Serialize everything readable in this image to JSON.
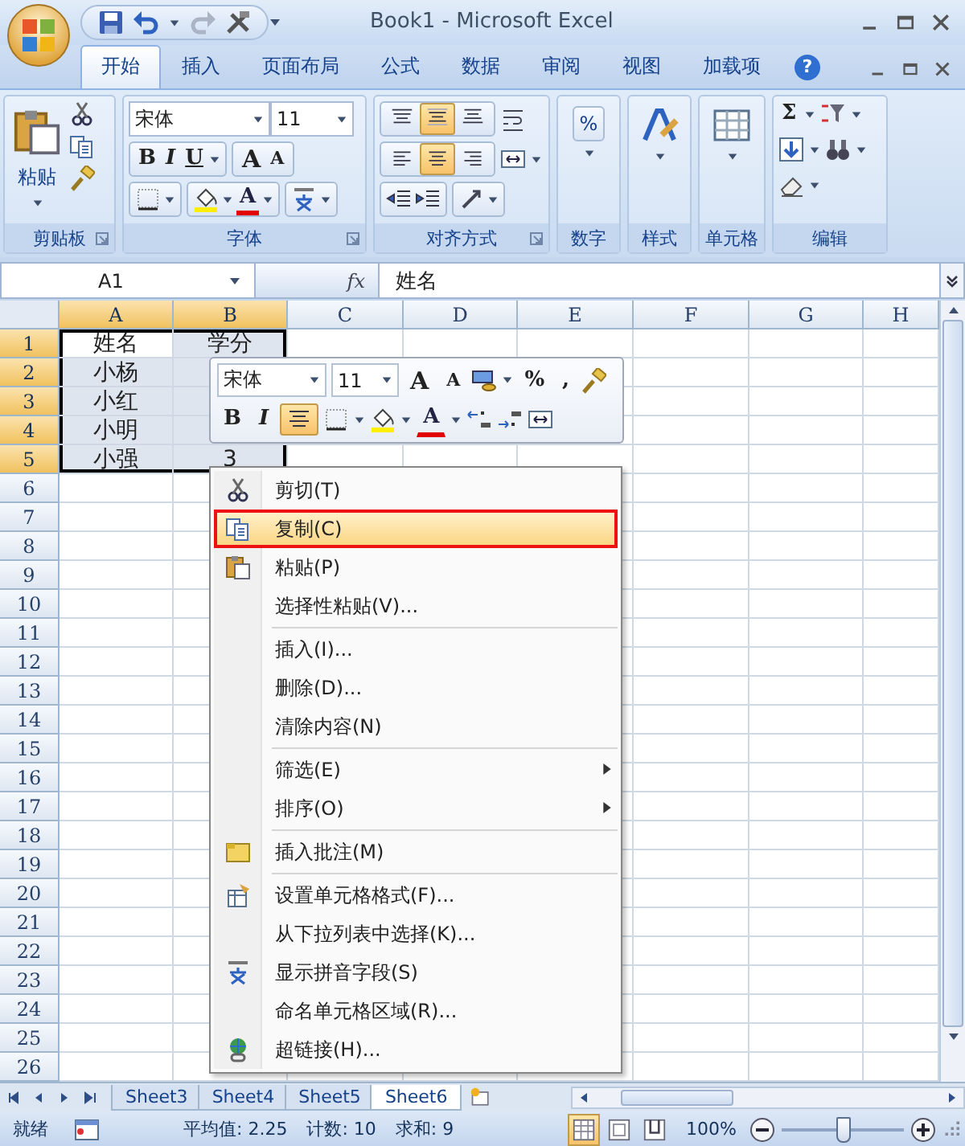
{
  "window": {
    "title": "Book1 - Microsoft Excel"
  },
  "ribbon_tabs": [
    {
      "label": "开始",
      "selected": true
    },
    {
      "label": "插入",
      "selected": false
    },
    {
      "label": "页面布局",
      "selected": false
    },
    {
      "label": "公式",
      "selected": false
    },
    {
      "label": "数据",
      "selected": false
    },
    {
      "label": "审阅",
      "selected": false
    },
    {
      "label": "视图",
      "selected": false
    },
    {
      "label": "加载项",
      "selected": false
    }
  ],
  "help_symbol": "?",
  "ribbon_groups": [
    {
      "kind": "clipboard",
      "label": "剪贴板",
      "paste": "粘贴"
    },
    {
      "kind": "font",
      "label": "字体",
      "font": "宋体",
      "size": "11",
      "styles": [
        "B",
        "I",
        "U"
      ],
      "grow": "A",
      "shrink": "A",
      "font_color": "A"
    },
    {
      "kind": "alignment",
      "label": "对齐方式",
      "vertical": [
        {
          "selected": false
        },
        {
          "selected": true
        },
        {
          "selected": false
        }
      ],
      "horizontal": [
        {
          "selected": false
        },
        {
          "selected": true
        },
        {
          "selected": false
        }
      ]
    },
    {
      "kind": "number",
      "label": "数字",
      "symbol": "%"
    },
    {
      "kind": "styles",
      "label": "样式"
    },
    {
      "kind": "cells",
      "label": "单元格"
    },
    {
      "kind": "editing",
      "label": "编辑",
      "sum_symbol": "Σ"
    }
  ],
  "formula_bar": {
    "name_box": "A1",
    "fx": "fx",
    "value": "姓名"
  },
  "columns": [
    {
      "label": "A",
      "selected": true
    },
    {
      "label": "B",
      "selected": true
    },
    {
      "label": "C",
      "selected": false
    },
    {
      "label": "D",
      "selected": false
    },
    {
      "label": "E",
      "selected": false
    },
    {
      "label": "F",
      "selected": false
    },
    {
      "label": "G",
      "selected": false
    },
    {
      "label": "H",
      "selected": false
    }
  ],
  "rows": [
    {
      "label": "1",
      "selected": true,
      "cells": [
        "姓名",
        "学分"
      ]
    },
    {
      "label": "2",
      "selected": true,
      "cells": [
        "小杨"
      ]
    },
    {
      "label": "3",
      "selected": true,
      "cells": [
        "小红"
      ]
    },
    {
      "label": "4",
      "selected": true,
      "cells": [
        "小明"
      ]
    },
    {
      "label": "5",
      "selected": true,
      "cells": [
        "小强",
        "3"
      ]
    },
    {
      "label": "6",
      "selected": false
    },
    {
      "label": "7",
      "selected": false
    },
    {
      "label": "8",
      "selected": false
    },
    {
      "label": "9",
      "selected": false
    },
    {
      "label": "10",
      "selected": false
    },
    {
      "label": "11",
      "selected": false
    },
    {
      "label": "12",
      "selected": false
    },
    {
      "label": "13",
      "selected": false
    },
    {
      "label": "14",
      "selected": false
    },
    {
      "label": "15",
      "selected": false
    },
    {
      "label": "16",
      "selected": false
    },
    {
      "label": "17",
      "selected": false
    },
    {
      "label": "18",
      "selected": false
    },
    {
      "label": "19",
      "selected": false
    },
    {
      "label": "20",
      "selected": false
    },
    {
      "label": "21",
      "selected": false
    },
    {
      "label": "22",
      "selected": false
    },
    {
      "label": "23",
      "selected": false
    },
    {
      "label": "24",
      "selected": false
    },
    {
      "label": "25",
      "selected": false
    },
    {
      "label": "26",
      "selected": false
    }
  ],
  "mini_toolbar": {
    "font": "宋体",
    "size": "11",
    "grow": "A",
    "shrink": "A",
    "percent": "%",
    "comma": ",",
    "bold": "B",
    "italic": "I",
    "center_selected": true,
    "font_color": "A"
  },
  "context_menu": {
    "items": [
      {
        "kind": "item",
        "label": "剪切(T)",
        "selected": false
      },
      {
        "kind": "item",
        "label": "复制(C)",
        "selected": true
      },
      {
        "kind": "item",
        "label": "粘贴(P)",
        "selected": false
      },
      {
        "kind": "item",
        "label": "选择性粘贴(V)...",
        "selected": false
      },
      {
        "kind": "separator"
      },
      {
        "kind": "item",
        "label": "插入(I)...",
        "selected": false
      },
      {
        "kind": "item",
        "label": "删除(D)...",
        "selected": false
      },
      {
        "kind": "item",
        "label": "清除内容(N)",
        "selected": false
      },
      {
        "kind": "separator"
      },
      {
        "kind": "item",
        "label": "筛选(E)",
        "selected": false,
        "submenu": true
      },
      {
        "kind": "item",
        "label": "排序(O)",
        "selected": false,
        "submenu": true
      },
      {
        "kind": "separator"
      },
      {
        "kind": "item",
        "label": "插入批注(M)",
        "selected": false
      },
      {
        "kind": "separator"
      },
      {
        "kind": "item",
        "label": "设置单元格格式(F)...",
        "selected": false
      },
      {
        "kind": "item",
        "label": "从下拉列表中选择(K)...",
        "selected": false
      },
      {
        "kind": "item",
        "label": "显示拼音字段(S)",
        "selected": false
      },
      {
        "kind": "item",
        "label": "命名单元格区域(R)...",
        "selected": false
      },
      {
        "kind": "item",
        "label": "超链接(H)...",
        "selected": false
      }
    ]
  },
  "sheet_tabs": [
    {
      "label": "Sheet3",
      "selected": false
    },
    {
      "label": "Sheet4",
      "selected": false
    },
    {
      "label": "Sheet5",
      "selected": false
    },
    {
      "label": "Sheet6",
      "selected": true
    }
  ],
  "status_bar": {
    "status": "就绪",
    "average": "平均值: 2.25",
    "count": "计数: 10",
    "sum": "求和: 9",
    "views": [
      {
        "selected": true
      },
      {
        "selected": false
      },
      {
        "selected": false
      }
    ],
    "zoom": "100%",
    "level": 0.5
  }
}
